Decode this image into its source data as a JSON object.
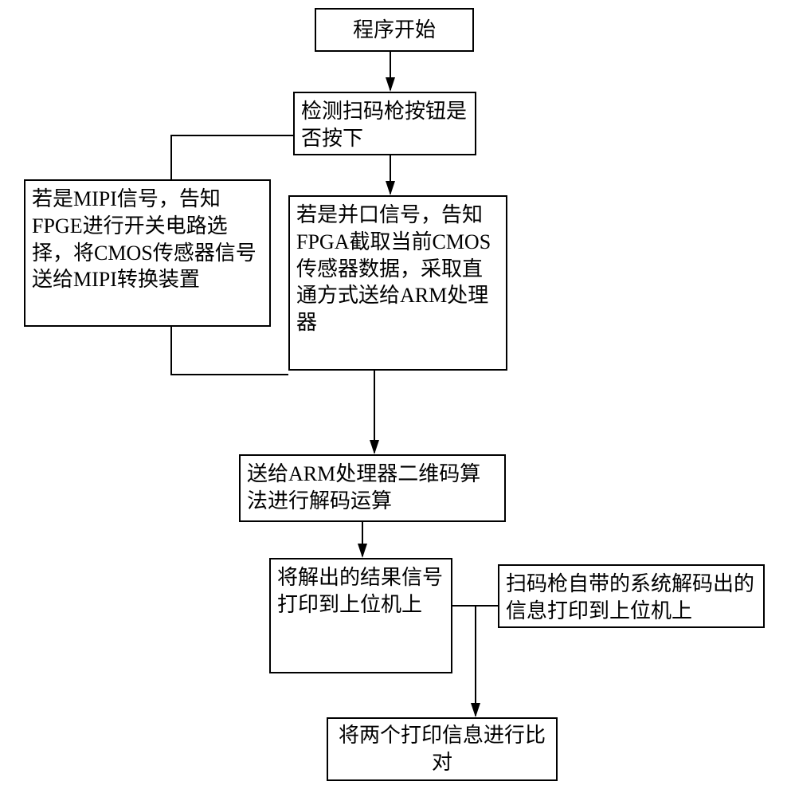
{
  "chart_data": {
    "type": "flowchart",
    "title": "",
    "nodes": [
      {
        "id": "n1",
        "label": "程序开始"
      },
      {
        "id": "n2",
        "label": "检测扫码枪按钮是否按下"
      },
      {
        "id": "n3",
        "label": "若是MIPI信号，告知FPGE进行开关电路选择，将CMOS传感器信号送给MIPI转换装置"
      },
      {
        "id": "n4",
        "label": "若是并口信号，告知FPGA截取当前CMOS传感器数据，采取直通方式送给ARM处理器"
      },
      {
        "id": "n5",
        "label": "送给ARM处理器二维码算法进行解码运算"
      },
      {
        "id": "n6",
        "label": "将解出的结果信号打印到上位机上"
      },
      {
        "id": "n7",
        "label": "扫码枪自带的系统解码出的信息打印到上位机上"
      },
      {
        "id": "n8",
        "label": "将两个打印信息进行比对"
      }
    ],
    "edges": [
      {
        "from": "n1",
        "to": "n2"
      },
      {
        "from": "n2",
        "to": "n3"
      },
      {
        "from": "n2",
        "to": "n4"
      },
      {
        "from": "n3",
        "to": "n5"
      },
      {
        "from": "n4",
        "to": "n5"
      },
      {
        "from": "n5",
        "to": "n6"
      },
      {
        "from": "n6",
        "to": "n8"
      },
      {
        "from": "n7",
        "to": "n8"
      }
    ]
  }
}
